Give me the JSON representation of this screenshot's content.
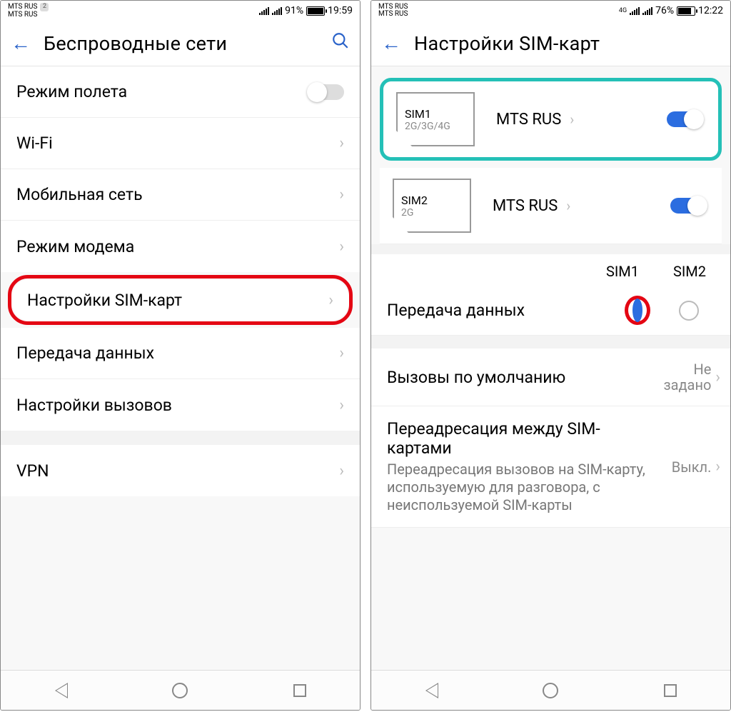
{
  "left": {
    "status": {
      "carrier1": "MTS RUS",
      "carrier2": "MTS RUS",
      "badge": "2",
      "battery_pct": "91%",
      "time": "19:59"
    },
    "header_title": "Беспроводные сети",
    "rows": {
      "airplane": "Режим полета",
      "wifi": "Wi-Fi",
      "mobile": "Мобильная сеть",
      "tether": "Режим модема",
      "sim": "Настройки SIM-карт",
      "data": "Передача данных",
      "calls": "Настройки вызовов",
      "vpn": "VPN"
    }
  },
  "right": {
    "status": {
      "carrier1": "MTS RUS",
      "carrier2": "MTS RUS",
      "net": "4G",
      "battery_pct": "76%",
      "time": "12:22"
    },
    "header_title": "Настройки SIM-карт",
    "sim1": {
      "name": "SIM1",
      "net": "2G/3G/4G",
      "carrier": "MTS RUS"
    },
    "sim2": {
      "name": "SIM2",
      "net": "2G",
      "carrier": "MTS RUS"
    },
    "col1": "SIM1",
    "col2": "SIM2",
    "data_label": "Передача данных",
    "default_calls": {
      "title": "Вызовы по умолчанию",
      "value": "Не задано"
    },
    "forward": {
      "title": "Переадресация между SIM-картами",
      "desc": "Переадресация вызовов на SIM-карту, используемую для разговора, с неиспользуемой SIM-карты",
      "value": "Выкл."
    }
  }
}
